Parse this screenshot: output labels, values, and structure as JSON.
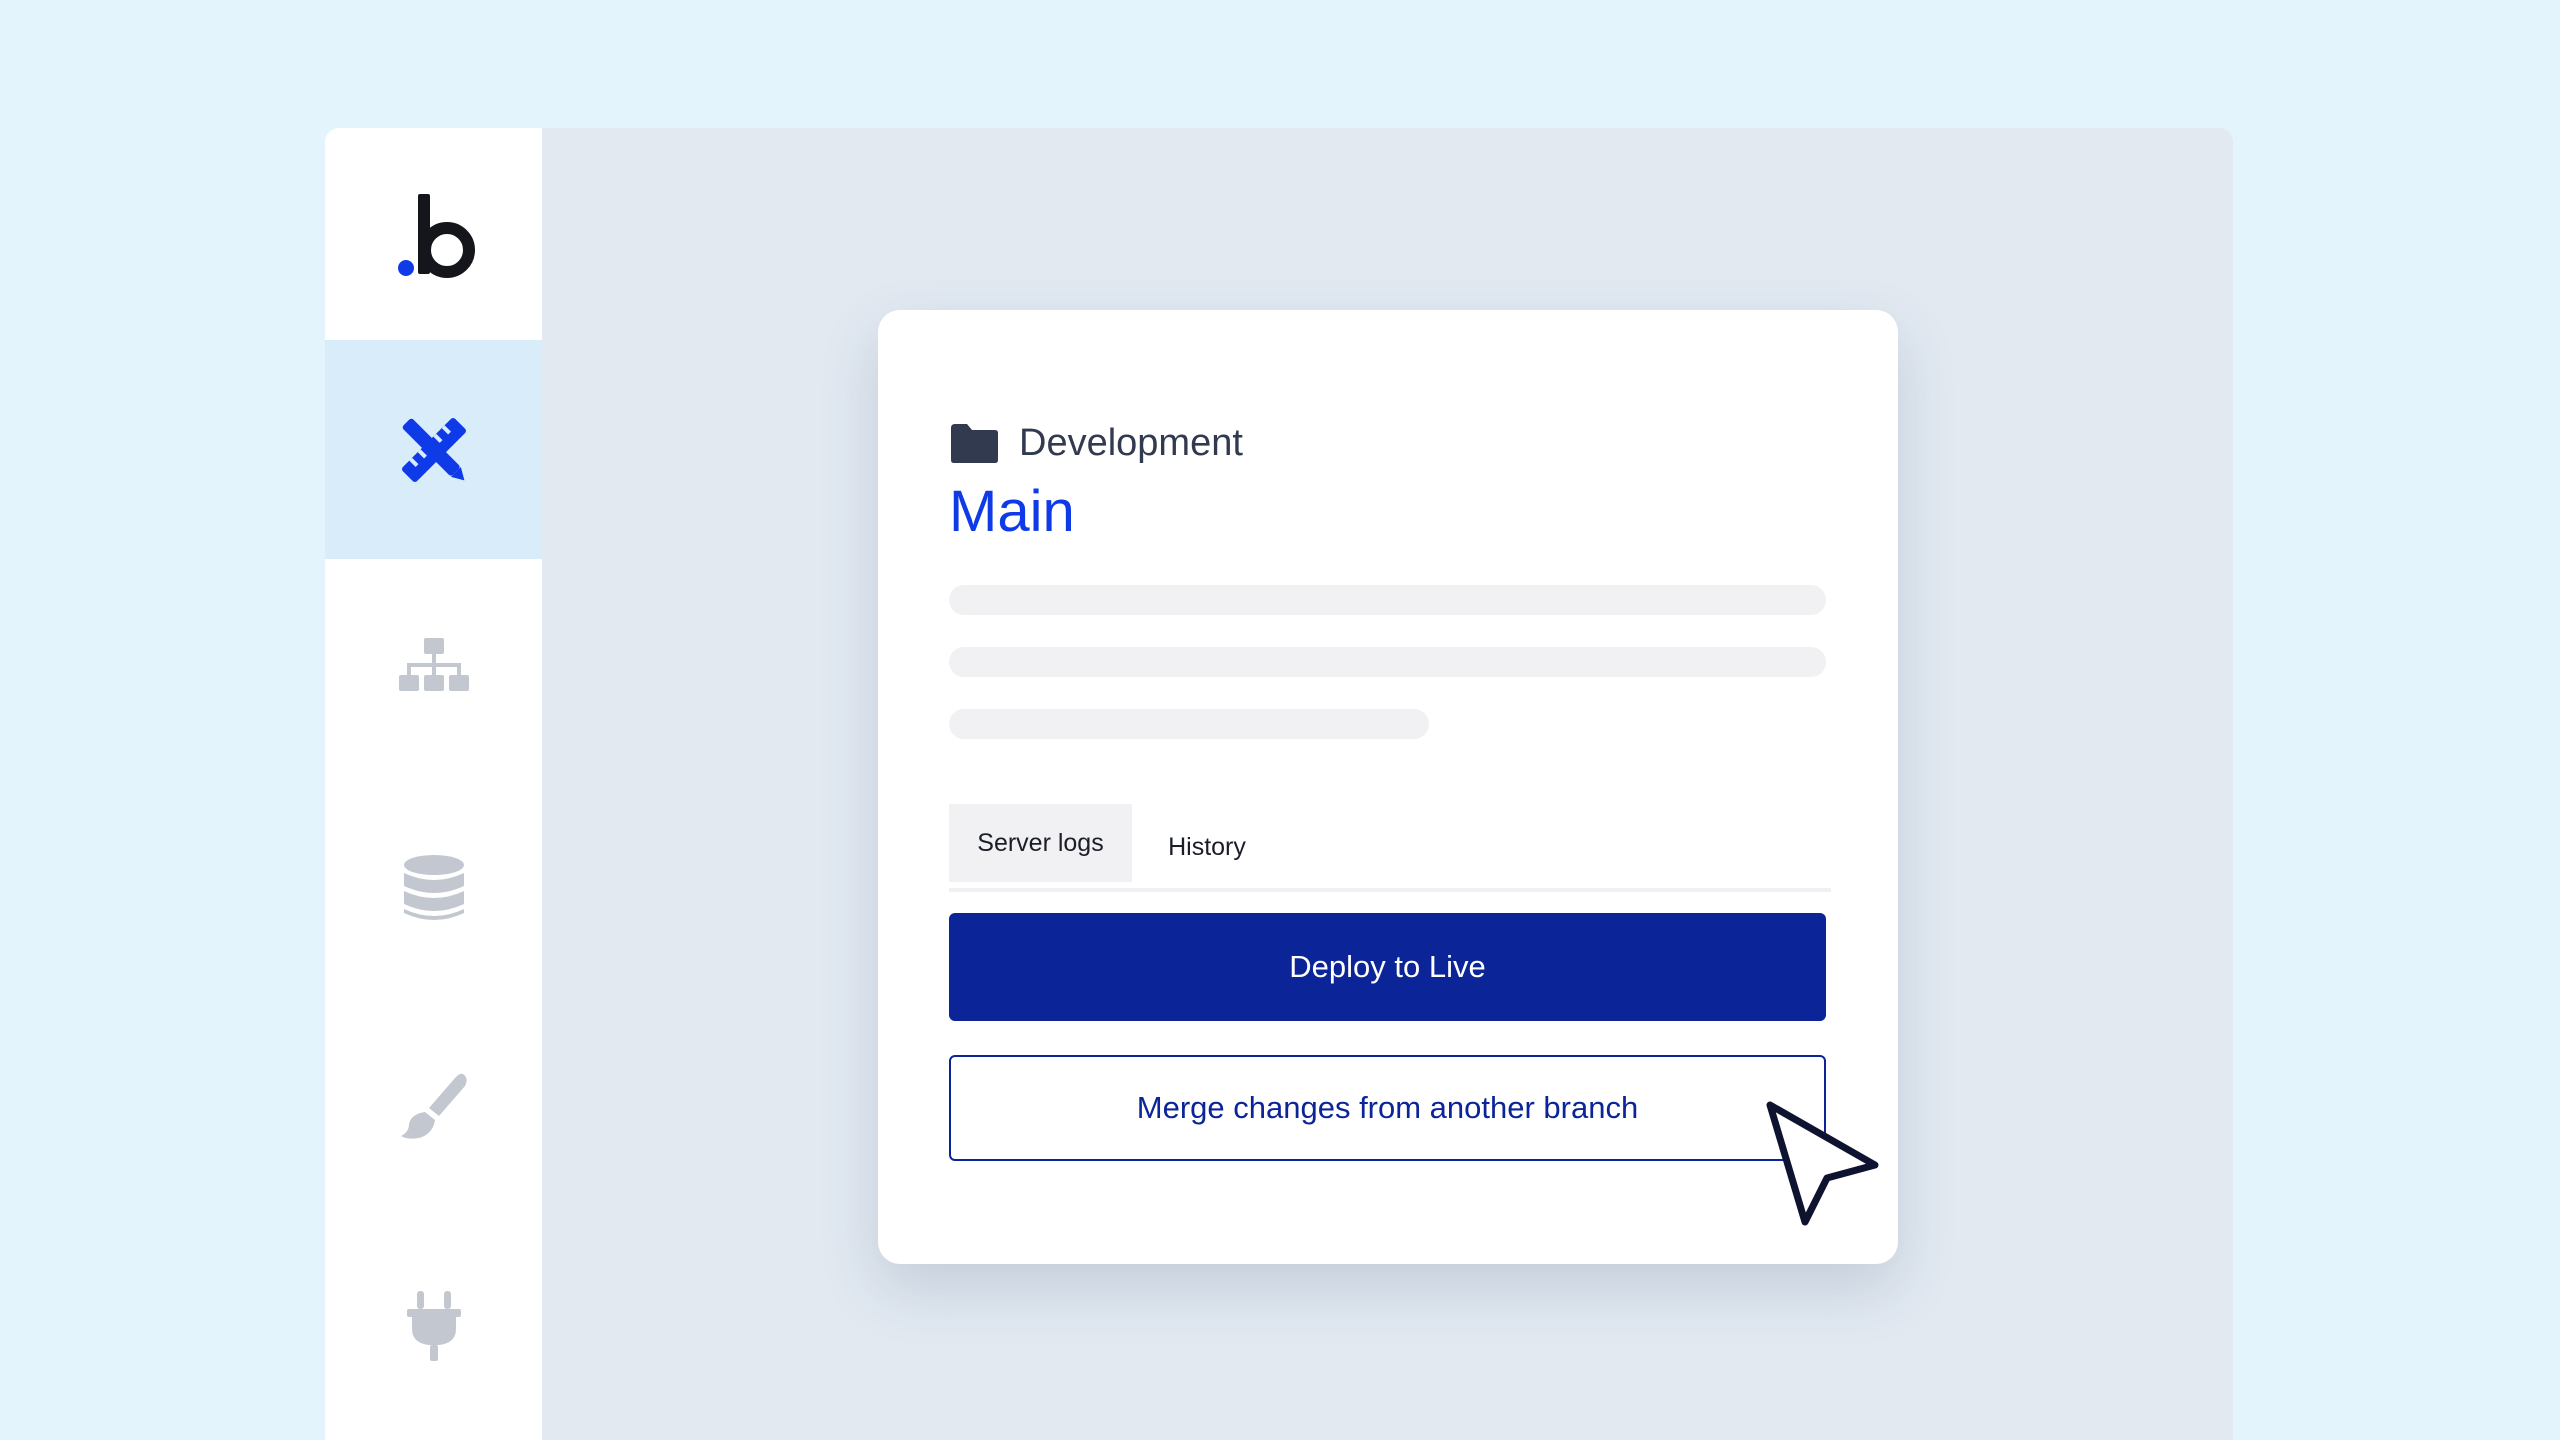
{
  "sidebar": {
    "logo": "bubble-logo",
    "items": [
      {
        "icon": "design-tools-icon",
        "active": true
      },
      {
        "icon": "sitemap-icon",
        "active": false
      },
      {
        "icon": "database-icon",
        "active": false
      },
      {
        "icon": "paintbrush-icon",
        "active": false
      },
      {
        "icon": "plug-icon",
        "active": false
      }
    ]
  },
  "card": {
    "environment": "Development",
    "branch": "Main",
    "tabs": [
      {
        "label": "Server logs",
        "active": true
      },
      {
        "label": "History",
        "active": false
      }
    ],
    "deploy_label": "Deploy to Live",
    "merge_label": "Merge changes from another branch"
  },
  "colors": {
    "accent": "#0f3ae8",
    "primary_button": "#0b2497",
    "page_background": "#e3f4fc",
    "workspace_background": "#e2e9f1",
    "active_nav_background": "#d8ecfa",
    "inactive_icon": "#c3c8d0"
  }
}
